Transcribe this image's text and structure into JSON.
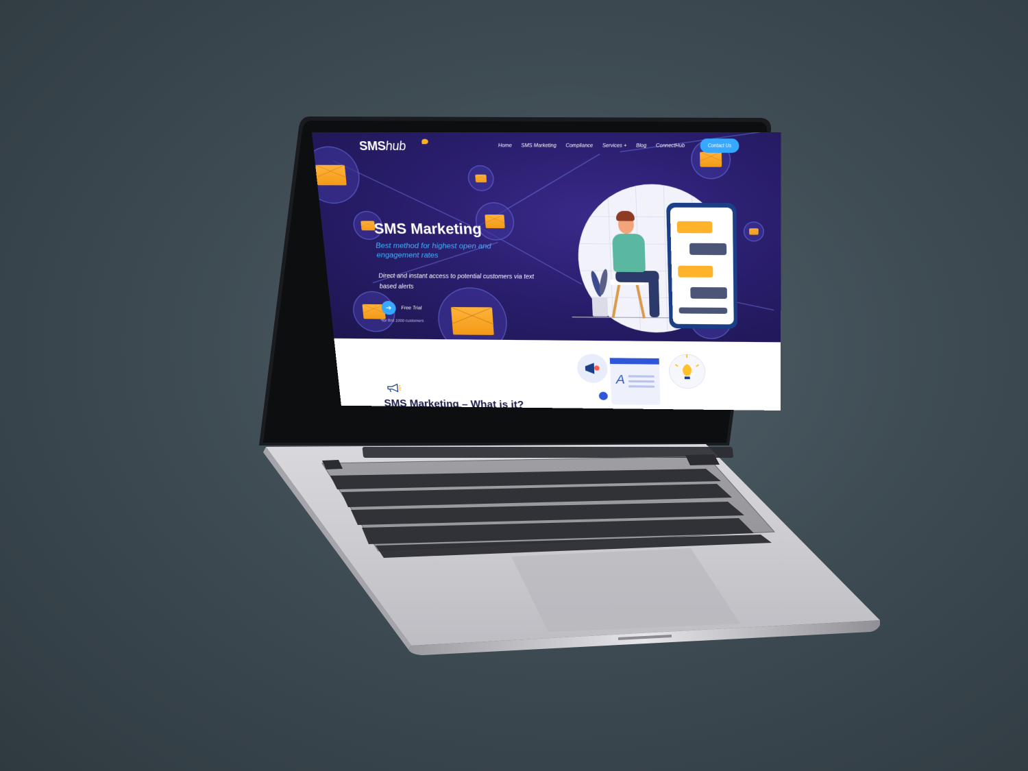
{
  "site": {
    "logo_sms": "SMS",
    "logo_hub": "hub",
    "nav": {
      "items": [
        "Home",
        "SMS Marketing",
        "Compliance",
        "Services +",
        "Blog",
        "ConnectHub"
      ],
      "contact_label": "Contact Us"
    },
    "hero": {
      "title": "SMS Marketing",
      "subtitle": "Best method for highest open and engagement rates",
      "description": "Direct and instant access to potential customers via text based alerts",
      "cta_label": "Free Trial",
      "cta_icon": "arrow-right-icon",
      "cta_note": "*for first 1000 customers"
    },
    "lower": {
      "icon": "megaphone-icon",
      "heading": "SMS Marketing – What is it?"
    }
  },
  "colors": {
    "hero_bg": "#2a1e6e",
    "accent_blue": "#36a8ff",
    "envelope_orange": "#f39a17",
    "phone_navy": "#1b3f86",
    "chat_yellow": "#ffb32b",
    "chat_slate": "#4a5578"
  }
}
